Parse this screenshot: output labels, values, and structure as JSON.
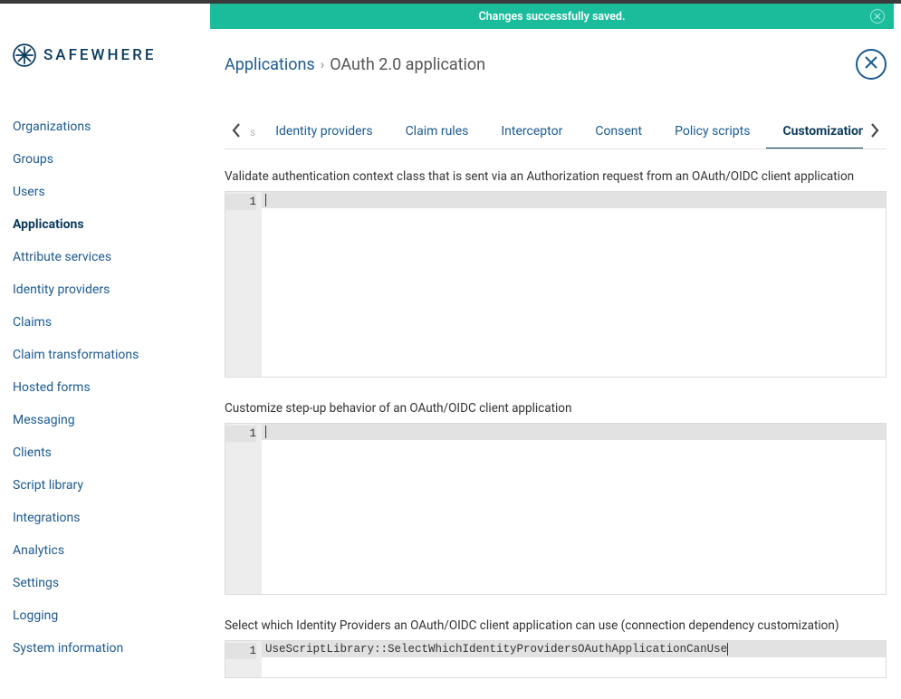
{
  "brand": {
    "name": "SAFEWHERE"
  },
  "notification": {
    "message": "Changes successfully saved."
  },
  "sidebar": {
    "items": [
      {
        "label": "Organizations",
        "active": false
      },
      {
        "label": "Groups",
        "active": false
      },
      {
        "label": "Users",
        "active": false
      },
      {
        "label": "Applications",
        "active": true
      },
      {
        "label": "Attribute services",
        "active": false
      },
      {
        "label": "Identity providers",
        "active": false
      },
      {
        "label": "Claims",
        "active": false
      },
      {
        "label": "Claim transformations",
        "active": false
      },
      {
        "label": "Hosted forms",
        "active": false
      },
      {
        "label": "Messaging",
        "active": false
      },
      {
        "label": "Clients",
        "active": false
      },
      {
        "label": "Script library",
        "active": false
      },
      {
        "label": "Integrations",
        "active": false
      },
      {
        "label": "Analytics",
        "active": false
      },
      {
        "label": "Settings",
        "active": false
      },
      {
        "label": "Logging",
        "active": false
      },
      {
        "label": "System information",
        "active": false
      }
    ]
  },
  "breadcrumb": {
    "parent": "Applications",
    "current": "OAuth 2.0 application"
  },
  "tabs": {
    "left_hint": "s",
    "items": [
      {
        "label": "Identity providers",
        "active": false
      },
      {
        "label": "Claim rules",
        "active": false
      },
      {
        "label": "Interceptor",
        "active": false
      },
      {
        "label": "Consent",
        "active": false
      },
      {
        "label": "Policy scripts",
        "active": false
      },
      {
        "label": "Customization",
        "active": true
      }
    ]
  },
  "sections": [
    {
      "label": "Validate authentication context class that is sent via an Authorization request from an OAuth/OIDC client application",
      "lineNumber": "1",
      "code": ""
    },
    {
      "label": "Customize step-up behavior of an OAuth/OIDC client application",
      "lineNumber": "1",
      "code": ""
    },
    {
      "label": "Select which Identity Providers an OAuth/OIDC client application can use (connection dependency customization)",
      "lineNumber": "1",
      "code": "UseScriptLibrary::SelectWhichIdentityProvidersOAuthApplicationCanUse"
    }
  ]
}
